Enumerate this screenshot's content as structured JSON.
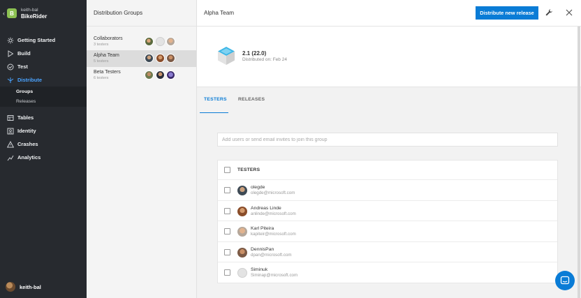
{
  "nav": {
    "app_owner": "keith-bal",
    "app_name": "BikeRider",
    "app_logo_letter": "B",
    "items": [
      {
        "label": "Getting Started",
        "icon": "sun-icon"
      },
      {
        "label": "Build",
        "icon": "play-icon"
      },
      {
        "label": "Test",
        "icon": "check-circle-icon"
      },
      {
        "label": "Distribute",
        "icon": "distribute-icon",
        "active": true
      },
      {
        "label": "Tables",
        "icon": "table-icon"
      },
      {
        "label": "Identity",
        "icon": "identity-icon"
      },
      {
        "label": "Crashes",
        "icon": "warning-icon"
      },
      {
        "label": "Analytics",
        "icon": "analytics-icon"
      }
    ],
    "sub_items": [
      {
        "label": "Groups",
        "active": true
      },
      {
        "label": "Releases"
      }
    ],
    "user_name": "keith-bal"
  },
  "groups": {
    "title": "Distribution Groups",
    "list": [
      {
        "name": "Collaborators",
        "count": "3 testers"
      },
      {
        "name": "Alpha Team",
        "count": "5 testers",
        "selected": true
      },
      {
        "name": "Beta Testers",
        "count": "6 testers"
      }
    ]
  },
  "main": {
    "title": "Alpha Team",
    "distribute_button": "Distribute new release",
    "release": {
      "version": "2.1 (22.0)",
      "date": "Distributed on: Feb 24"
    },
    "tabs": [
      "TESTERS",
      "RELEASES"
    ],
    "invite_placeholder": "Add users or send email invites to join this group",
    "table_header": "TESTERS",
    "testers": [
      {
        "name": "olegde",
        "email": "olegde@microsoft.com"
      },
      {
        "name": "Andreas Linde",
        "email": "anlinde@microsoft.com"
      },
      {
        "name": "Karl Piteira",
        "email": "kapiteir@microsoft.com"
      },
      {
        "name": "DennisPan",
        "email": "dpan@microsoft.com"
      },
      {
        "name": "Siminuk",
        "email": "Siminap@microsoft.com"
      }
    ]
  },
  "colors": {
    "accent": "#0a7cd6",
    "nav_bg": "#272a2f",
    "app_logo": "#8cc152"
  }
}
